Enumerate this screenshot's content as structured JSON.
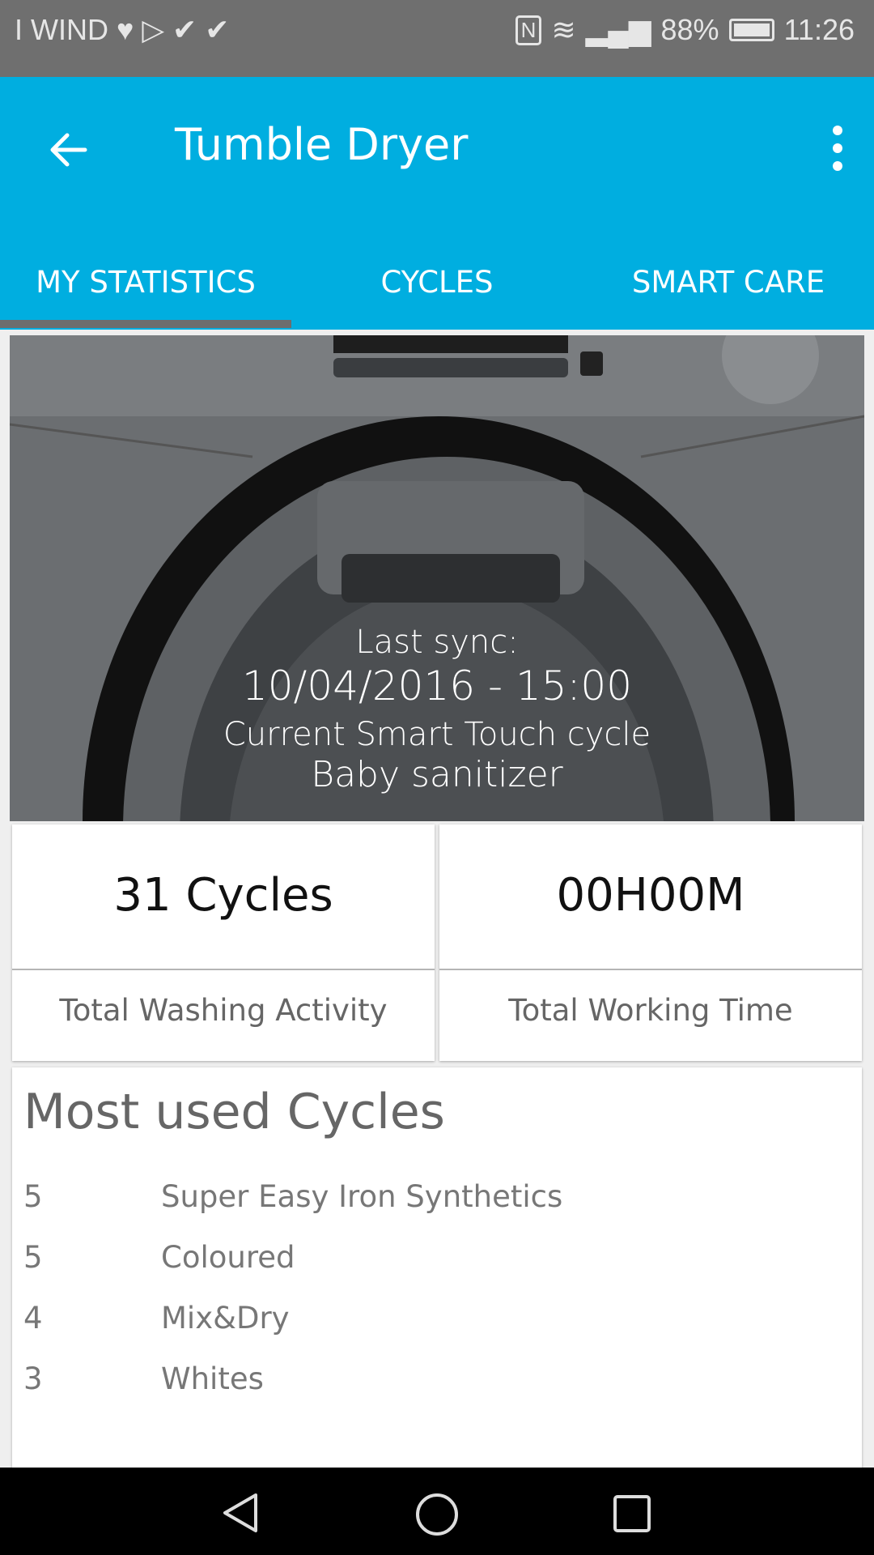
{
  "status_bar": {
    "carrier": "I WIND",
    "battery": "88%",
    "time": "11:26",
    "icons": [
      "heart-rate-icon",
      "play-store-icon",
      "check-icon",
      "check-icon",
      "nfc-icon",
      "wifi-icon",
      "signal-icon",
      "battery-icon"
    ]
  },
  "app_bar": {
    "title": "Tumble Dryer",
    "back_icon": "arrow-left-icon",
    "menu_icon": "more-vert-icon",
    "color": "#00aee0"
  },
  "tabs": [
    {
      "label": "MY STATISTICS",
      "selected": true
    },
    {
      "label": "CYCLES",
      "selected": false
    },
    {
      "label": "SMART CARE",
      "selected": false
    }
  ],
  "hero": {
    "last_sync_label": "Last sync:",
    "last_sync": "10/04/2016 - 15:00",
    "current_label": "Current Smart Touch cycle",
    "current_cycle": "Baby sanitizer"
  },
  "stats": [
    {
      "value": "31 Cycles",
      "label": "Total Washing Activity"
    },
    {
      "value": "00H00M",
      "label": "Total Working Time"
    }
  ],
  "most_used": {
    "title": "Most used Cycles",
    "rows": [
      {
        "count": "5",
        "name": "Super Easy Iron Synthetics"
      },
      {
        "count": "5",
        "name": "Coloured"
      },
      {
        "count": "4",
        "name": "Mix&Dry"
      },
      {
        "count": "3",
        "name": "Whites"
      }
    ]
  }
}
